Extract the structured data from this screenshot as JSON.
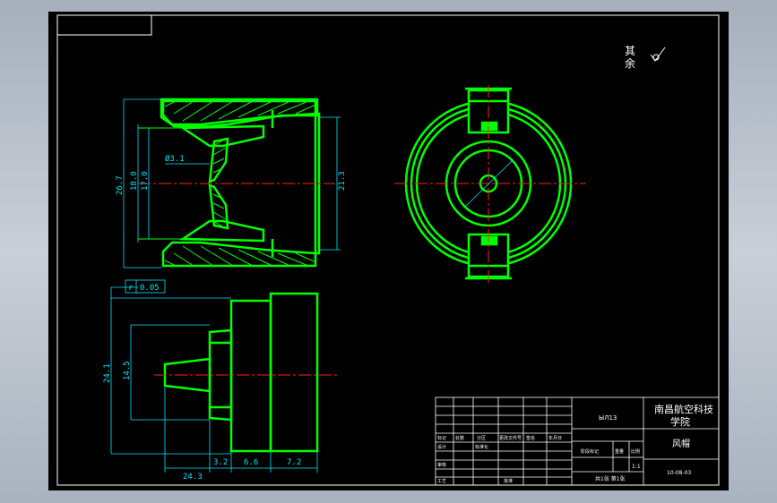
{
  "notes": {
    "qita": "其",
    "yu": "余"
  },
  "dimensions": {
    "front_outer": "26.7",
    "front_mid": "18.0",
    "front_inner": "17.0",
    "front_hole": "Ø3.1",
    "front_right": "21.3",
    "section_total": "24.1",
    "section_mid": "14.5",
    "section_len": "24.3",
    "seg1": "3.2",
    "seg2": "6.6",
    "seg3": "7.2",
    "tolerance_sym": "r",
    "tolerance_val": "0.05"
  },
  "title_block": {
    "code": "ЫЛ13",
    "school": "南昌航空科技",
    "school2": "学院",
    "part_name": "风帽",
    "drawing_no": "10-08-03",
    "scale": "1:1",
    "sheet_info": "共1张 第1张",
    "labels": [
      "标记",
      "处数",
      "分区",
      "更改文件号",
      "签名",
      "年月日",
      "设计",
      "标准化",
      "审核",
      "工艺",
      "批准",
      "阶段标记",
      "重量",
      "比例"
    ]
  }
}
